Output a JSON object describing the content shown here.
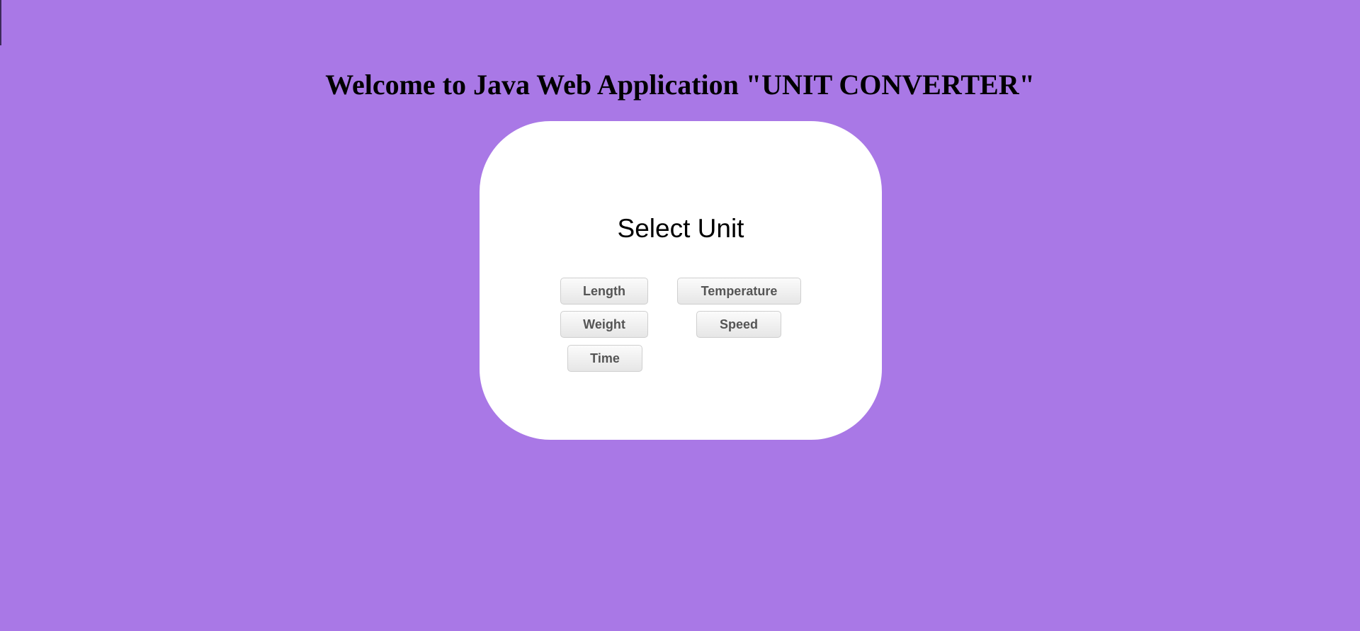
{
  "header": {
    "title": "Welcome to Java Web Application \"UNIT CONVERTER\""
  },
  "card": {
    "title": "Select Unit",
    "buttons": {
      "length": "Length",
      "temperature": "Temperature",
      "weight": "Weight",
      "speed": "Speed",
      "time": "Time"
    }
  },
  "colors": {
    "background": "#a978e6",
    "card": "#ffffff",
    "button_text": "#555555"
  }
}
